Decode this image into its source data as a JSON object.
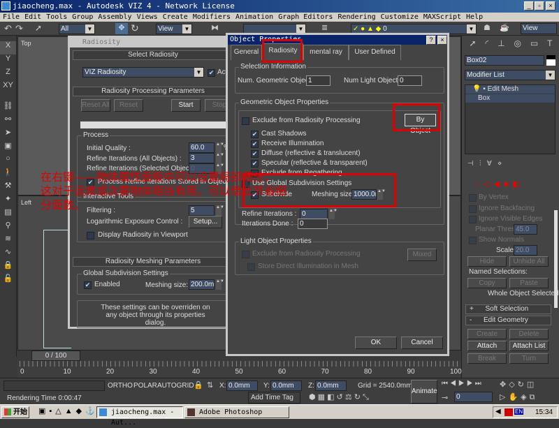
{
  "window": {
    "title": "jiaocheng.max - Autodesk VIZ 4 - Network License"
  },
  "menu": [
    "File",
    "Edit",
    "Tools",
    "Group",
    "Assembly",
    "Views",
    "Create",
    "Modifiers",
    "Animation",
    "Graph Editors",
    "Rendering",
    "Customize",
    "MAXScript",
    "Help"
  ],
  "toolbar": {
    "selection_filter": "All",
    "ref_coord": "View",
    "layer": "0",
    "render_view": "View"
  },
  "left_icons": [
    "X",
    "Y",
    "Z",
    "XY"
  ],
  "viewports": {
    "top_label": "Top",
    "left_label": "Left"
  },
  "radiosity": {
    "title": "Radiosity",
    "select_header": "Select Radiosity",
    "engine": "VIZ Radiosity",
    "active_label": "Active",
    "processing_header": "Radiosity Processing Parameters",
    "buttons": {
      "reset_all": "Reset All",
      "reset": "Reset",
      "start": "Start",
      "stop": "Stop"
    },
    "process_label": "Process",
    "initial_quality_label": "Initial Quality :",
    "initial_quality": "60.0",
    "initial_quality_unit": "%",
    "refine_all_label": "Refine Iterations (All Objects) :",
    "refine_all": "3",
    "refine_sel_label": "Refine Iterations (Selected Objects) :",
    "refine_sel": "0",
    "process_stored_label": "Process Refine Iterations Stored in Objects",
    "interactive_label": "Interactive Tools",
    "filtering_label": "Filtering :",
    "filtering": "5",
    "exposure_label": "Logarithmic Exposure Control :",
    "setup": "Setup...",
    "display_label": "Display Radiosity in Viewport",
    "meshing_header": "Radiosity Meshing Parameters",
    "global_label": "Global Subdivision Settings",
    "enabled_label": "Enabled",
    "meshing_size_label": "Meshing size:",
    "meshing_size": "200.0mm",
    "note": "These settings can be overriden on any object through its properties dialog."
  },
  "objprops": {
    "title": "Object Properties",
    "tabs": [
      "General",
      "Radiosity",
      "mental ray",
      "User Defined"
    ],
    "sel_info": "Selection Information",
    "num_geo_label": "Num. Geometric Objects:",
    "num_geo": "1",
    "num_light_label": "Num Light Objects:",
    "num_light": "0",
    "geo_props": "Geometric Object Properties",
    "exclude_label": "Exclude from Radiosity Processing",
    "by_object": "By Object",
    "cast_shadows": "Cast Shadows",
    "receive_illum": "Receive Illumination",
    "diffuse": "Diffuse (reflective & translucent)",
    "specular": "Specular (reflective & transparent)",
    "exclude_regather": "Exclude from Regathering",
    "use_global": "Use Global Subdivision Settings",
    "subdivide": "Subdivide",
    "meshing_size_label": "Meshing size:",
    "meshing_size": "1000.0mm",
    "refine_label": "Refine Iterations :",
    "refine": "0",
    "done_label": "Iterations Done :",
    "done": "0",
    "light_props": "Light Object Properties",
    "light_exclude": "Exclude from Radiosity Processing",
    "mixed": "Mixed",
    "store_direct": "Store Direct Illumination in Mesh",
    "ok": "OK",
    "cancel": "Cancel"
  },
  "annotation": [
    "在右键——物体属性面板中可以设置局部细分，",
    "这对于远景或次要物体相当有用，可以借此节省细",
    "分面数。"
  ],
  "command_panel": {
    "object_name": "Box02",
    "modifier_list": "Modifier List",
    "stack": [
      "Edit Mesh",
      "Box"
    ],
    "by_vertex": "By Vertex",
    "ignore_backfacing": "Ignore Backfacing",
    "ignore_visible": "Ignore Visible Edges",
    "planar_label": "Planar Thresh:",
    "planar": "45.0",
    "show_normals": "Show Normals",
    "scale_label": "Scale:",
    "scale": "20.0",
    "hide": "Hide",
    "unhide_all": "Unhide All",
    "named_sel": "Named Selections:",
    "copy": "Copy",
    "paste": "Paste",
    "whole_obj": "Whole Object Selected",
    "soft_sel": "Soft Selection",
    "edit_geo": "Edit Geometry",
    "create": "Create",
    "delete": "Delete",
    "attach": "Attach",
    "attach_list": "Attach List",
    "break": "Break",
    "turn": "Turn",
    "plus": "+",
    "minus": "-"
  },
  "timeline": {
    "slider": "0 / 100",
    "ticks": [
      "0",
      "10",
      "20",
      "30",
      "40",
      "50",
      "60",
      "70",
      "80",
      "90",
      "100"
    ]
  },
  "status": {
    "ortho": "ORTHO",
    "polar": "POLAR",
    "autogrid": "AUTOGRID",
    "x_label": "X:",
    "x": "0.0mm",
    "y_label": "Y:",
    "y": "0.0mm",
    "z_label": "Z:",
    "z": "0.0mm",
    "grid": "Grid = 2540.0mm",
    "render_time": "Rendering Time  0:00:47",
    "add_time_tag": "Add Time Tag",
    "animate": "Animate",
    "frame": "0"
  },
  "taskbar": {
    "start": "开始",
    "task1": "jiaocheng.max - Aut...",
    "task2": "Adobe Photoshop",
    "ime": "EN",
    "clock": "15:34"
  }
}
